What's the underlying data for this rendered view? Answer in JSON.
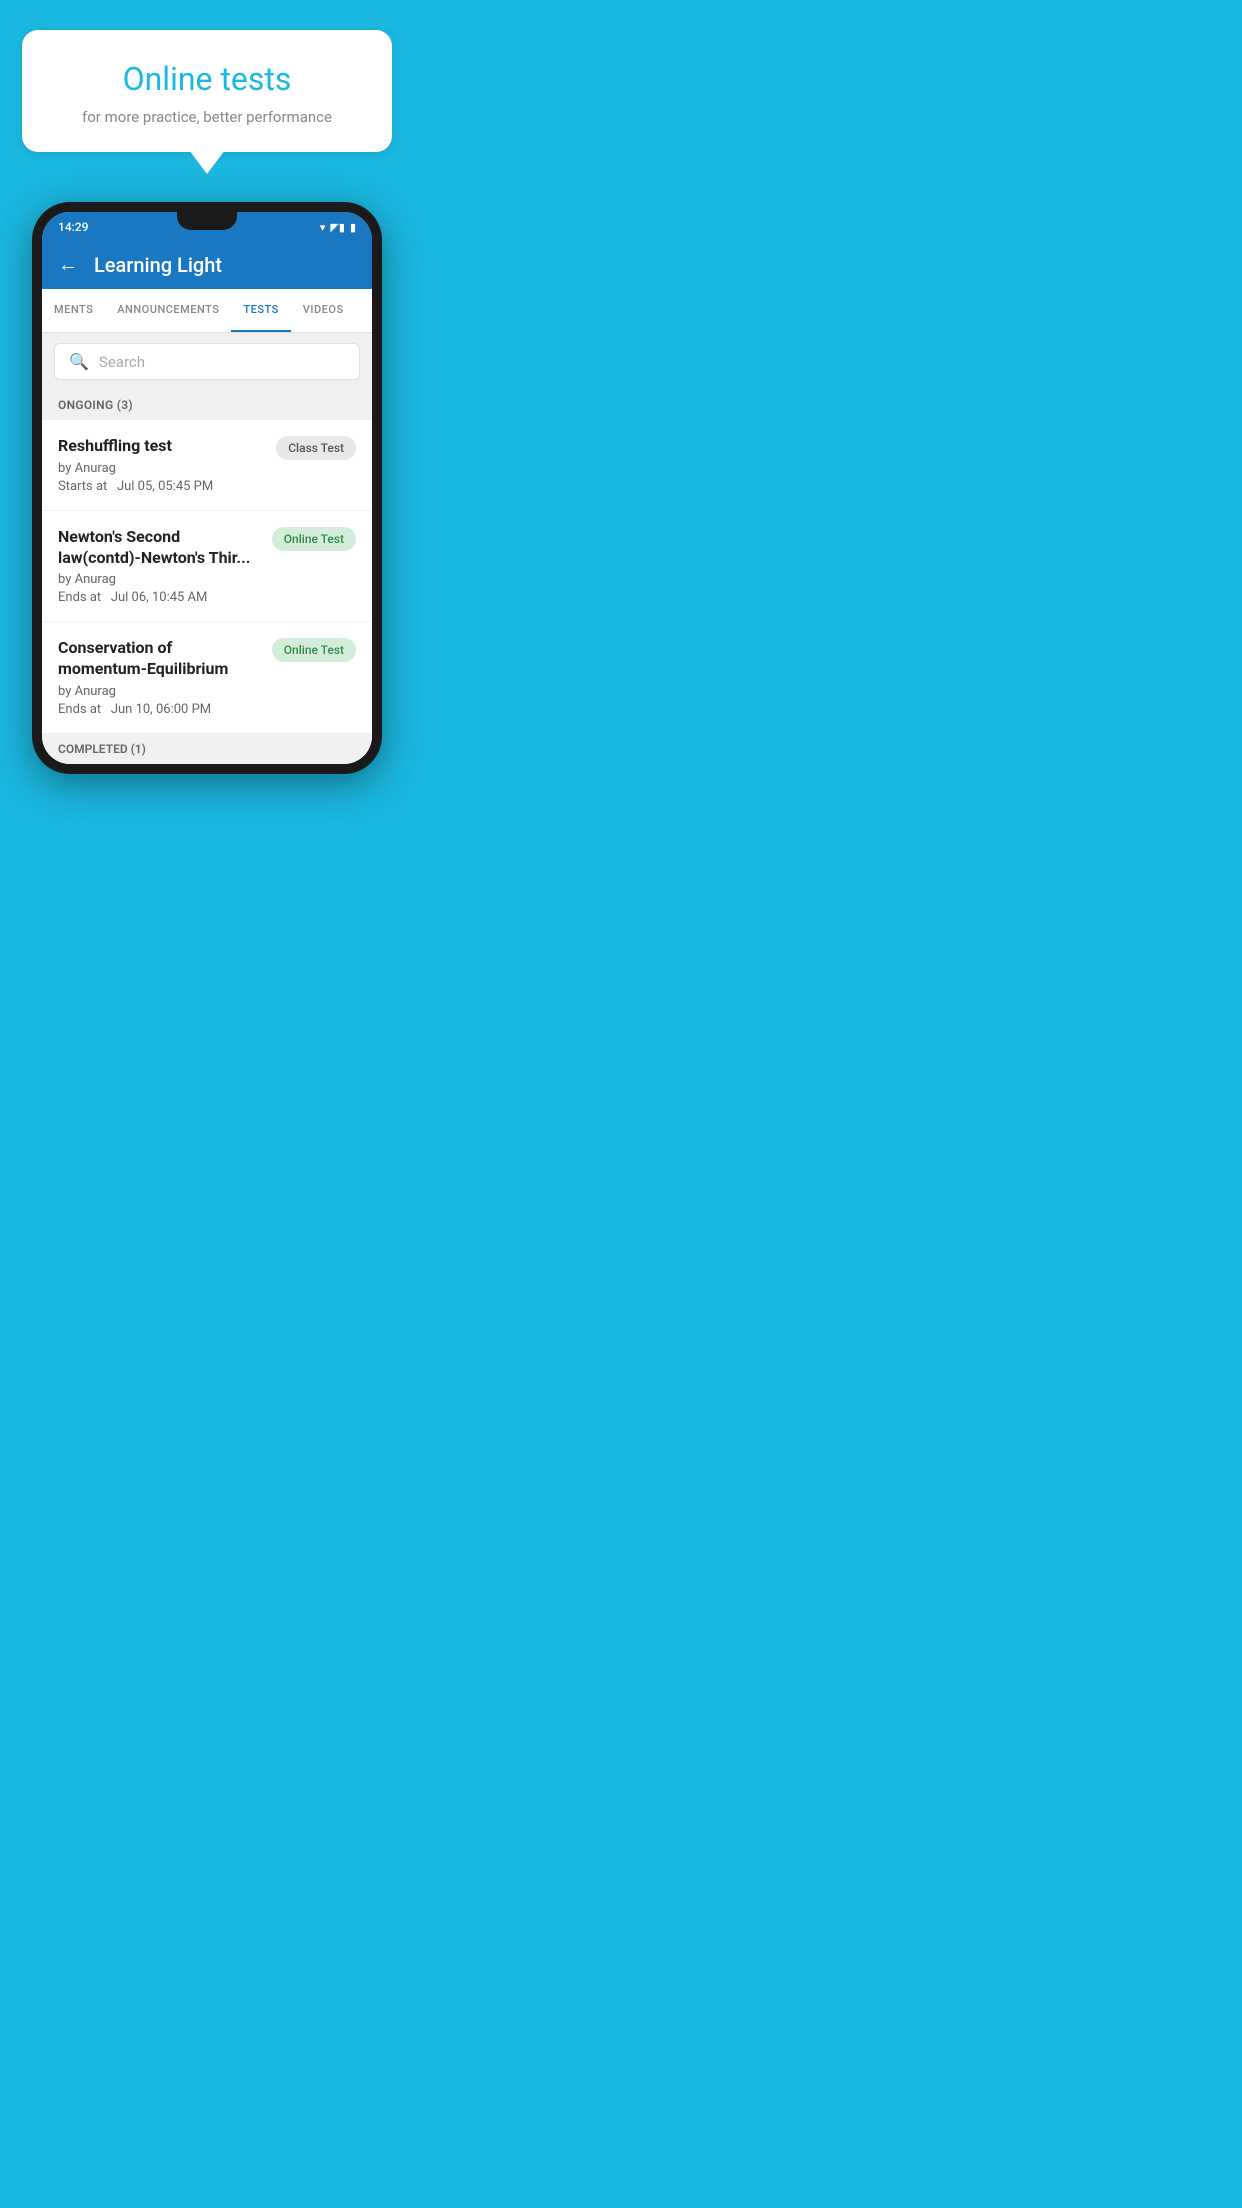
{
  "background": {
    "color": "#1BB8E0"
  },
  "speech_bubble": {
    "title": "Online tests",
    "subtitle": "for more practice, better performance"
  },
  "status_bar": {
    "time": "14:29",
    "wifi": "▼",
    "signal": "▲▲",
    "battery": "▮"
  },
  "app_header": {
    "back_label": "←",
    "title": "Learning Light"
  },
  "tabs": [
    {
      "label": "MENTS",
      "active": false
    },
    {
      "label": "ANNOUNCEMENTS",
      "active": false
    },
    {
      "label": "TESTS",
      "active": true
    },
    {
      "label": "VIDEOS",
      "active": false
    }
  ],
  "search": {
    "placeholder": "Search"
  },
  "ongoing_section": {
    "header": "ONGOING (3)",
    "tests": [
      {
        "name": "Reshuffling test",
        "author": "by Anurag",
        "time": "Starts at  Jul 05, 05:45 PM",
        "badge": "Class Test",
        "badge_type": "gray"
      },
      {
        "name": "Newton's Second law(contd)-Newton's Thir...",
        "author": "by Anurag",
        "time": "Ends at  Jul 06, 10:45 AM",
        "badge": "Online Test",
        "badge_type": "green"
      },
      {
        "name": "Conservation of momentum-Equilibrium",
        "author": "by Anurag",
        "time": "Ends at  Jun 10, 06:00 PM",
        "badge": "Online Test",
        "badge_type": "green"
      }
    ]
  },
  "completed_section": {
    "header": "COMPLETED (1)"
  }
}
